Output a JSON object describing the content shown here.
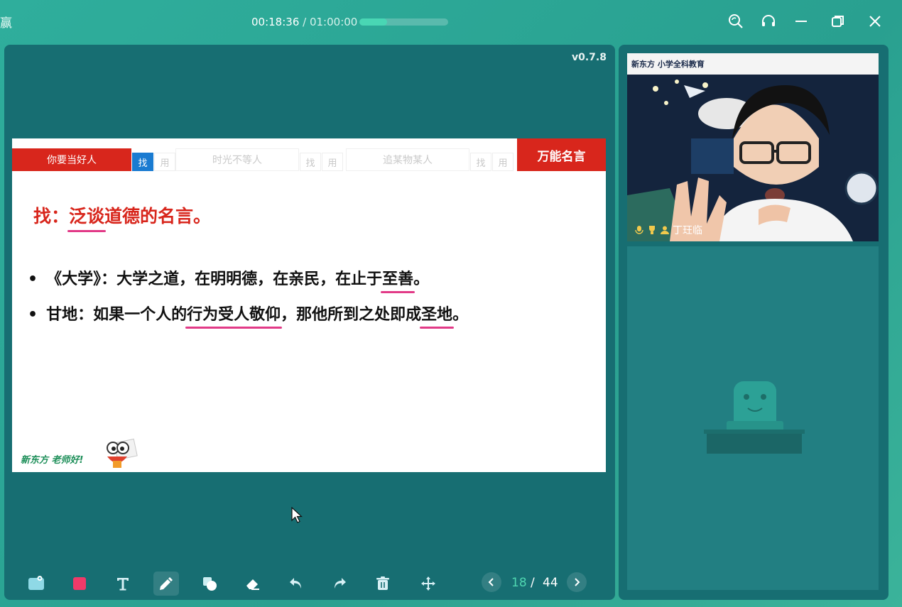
{
  "titlebar": {
    "app_char": "赢",
    "elapsed": "00:18:36",
    "separator": " / ",
    "total": "01:00:00",
    "progress_fraction": 0.31
  },
  "main": {
    "version": "v0.7.8",
    "slide": {
      "tabs": {
        "active_label": "你要当好人",
        "find_tag": "找",
        "use_tag": "用",
        "tab2_label": "时光不等人",
        "tab3_label": "追某物某人",
        "title": "万能名言"
      },
      "heading_prefix": "找：",
      "heading_underlined": "泛谈",
      "heading_rest": "道德的名言。",
      "bullet1": {
        "text": "《大学》：大学之道，在明明德，在亲民，在止于",
        "underlined": "至善",
        "end": "。"
      },
      "bullet2": {
        "text": "甘地：如果一个人的",
        "underlined1": "行为受人敬仰",
        "middle": "，那他所到之处即成",
        "underlined2": "圣地",
        "end": "。"
      },
      "footer": "新东方 老师好!"
    }
  },
  "pager": {
    "current": "18",
    "separator": "/",
    "total": "44"
  },
  "side": {
    "teacher_name": "丁玨临",
    "banner_text": "新东方  小学全科教育"
  },
  "colors": {
    "accent_red": "#d8261c",
    "underline_pink": "#e23a87",
    "pager_current": "#4fd6b0"
  }
}
